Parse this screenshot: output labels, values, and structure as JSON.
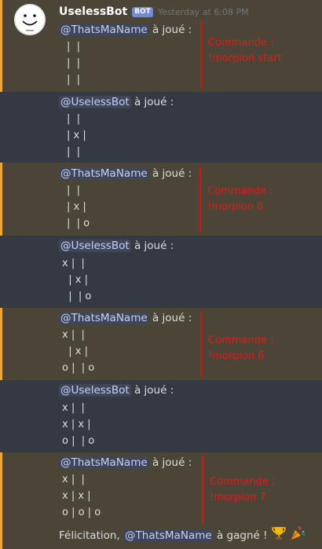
{
  "header": {
    "username": "UselessBot",
    "badge": "BOT",
    "timestamp": "Yesterday at 6:08 PM"
  },
  "played_suffix": "à joué :",
  "messages": [
    {
      "mention": "@ThatsMaName",
      "rows": [
        "|  |",
        "|  |",
        "|  |"
      ],
      "note": [
        "Commande :",
        "!morpion start"
      ]
    },
    {
      "mention": "@UselessBot",
      "rows": [
        "|  |",
        "| x |",
        "|  |"
      ]
    },
    {
      "mention": "@ThatsMaName",
      "rows": [
        "|  |",
        "| x |",
        "|  | o"
      ],
      "note": [
        "Commande :",
        "!morpion 8"
      ]
    },
    {
      "mention": "@UselessBot",
      "rows": [
        "x |  |",
        "  | x |",
        "  |  | o"
      ]
    },
    {
      "mention": "@ThatsMaName",
      "rows": [
        "x |  |",
        "  | x |",
        "o |  | o"
      ],
      "note": [
        "Commande :",
        "!morpion 6"
      ]
    },
    {
      "mention": "@UselessBot",
      "rows": [
        "x |  |",
        "x | x |",
        "o |  | o"
      ]
    },
    {
      "mention": "@ThatsMaName",
      "rows": [
        "x |  |",
        "x | x |",
        "o | o | o"
      ],
      "note": [
        "Commande :",
        "!morpion 7"
      ]
    }
  ],
  "final": {
    "prefix": "Félicitation,",
    "mention": "@ThatsMaName",
    "suffix": "à gagné !",
    "emojis": [
      "trophy-emoji",
      "party-popper-emoji"
    ]
  }
}
